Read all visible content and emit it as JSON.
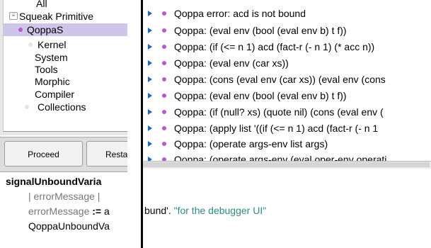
{
  "category_list": {
    "items": [
      {
        "label": "All",
        "icon": "none"
      },
      {
        "label": "Squeak Primitive",
        "icon": "package-icon"
      },
      {
        "label": "QoppaS",
        "icon": "bullet-purple",
        "selected": true
      },
      {
        "label": "Kernel",
        "icon": "bullet-grey"
      },
      {
        "label": "System",
        "icon": "none"
      },
      {
        "label": "Tools",
        "icon": "none"
      },
      {
        "label": "Morphic",
        "icon": "none"
      },
      {
        "label": "Compiler",
        "icon": "none"
      },
      {
        "label": "Collections",
        "icon": "bullet-grey"
      }
    ]
  },
  "buttons": {
    "proceed": "Proceed",
    "restart": "Resta"
  },
  "method_source": {
    "name": "signalUnboundVaria",
    "line2": "| errorMessage |",
    "line3_var": "errorMessage",
    "line3_assign": ":=",
    "line3_rest": "a",
    "line4": "QoppaUnboundVa"
  },
  "stack": {
    "frames": [
      "Qoppa error: acd is not bound",
      "Qoppa: (eval env (bool (eval env b) t f))",
      "Qoppa: (if (<= n 1) acd (fact-r (- n 1) (* acc n))",
      "Qoppa: (eval env (car xs))",
      "Qoppa: (cons (eval env (car xs)) (eval env (cons",
      "Qoppa: (eval env (bool (eval env b) t f))",
      "Qoppa: (if (null? xs) (quote nil) (cons (eval env (",
      "Qoppa: (apply list '((if (<= n 1) acd (fact-r (- n 1",
      "Qoppa: (operate args-env list args)",
      "Qoppa: (operate args-env (eval oper-env operati"
    ]
  },
  "right_source": {
    "string_part": "bund'.",
    "comment_part": "\"for the debugger UI\""
  },
  "colors": {
    "selection": "#cdc6ea",
    "bullet": "#b35ccc",
    "arrow": "#1a66c4",
    "comment": "#2d8a84"
  }
}
